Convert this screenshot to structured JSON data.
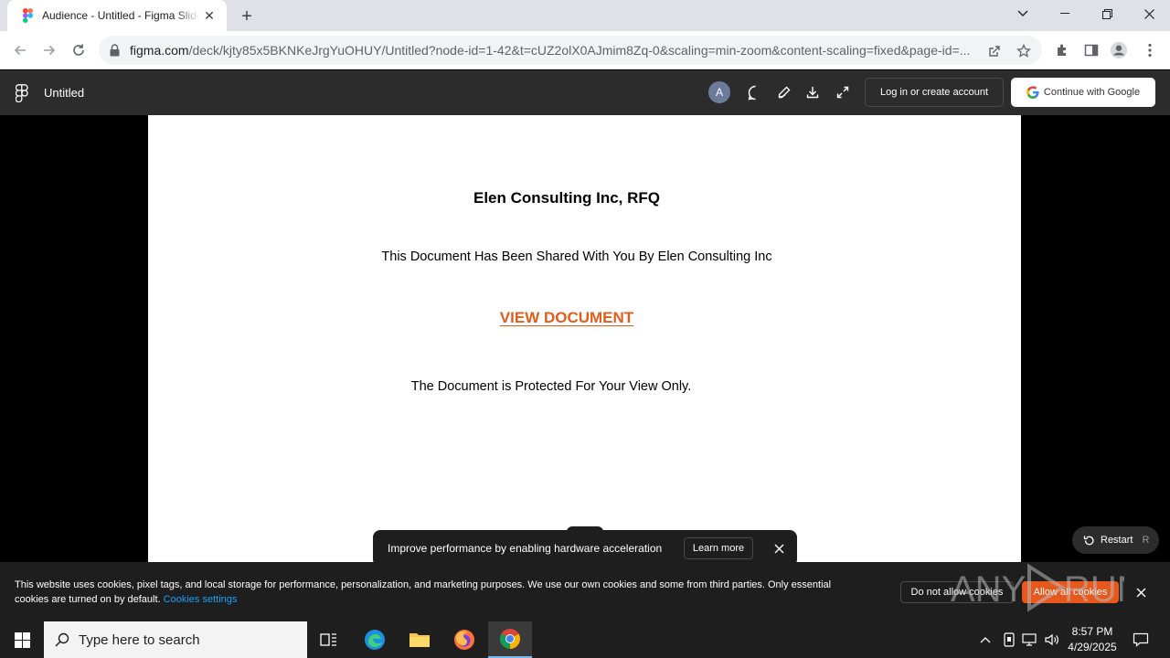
{
  "browser": {
    "tab_title": "Audience - Untitled - Figma Slides",
    "url_host": "figma.com",
    "url_path": "/deck/kjty85x5BKNKeJrgYuOHUY/Untitled?node-id=1-42&t=cUZ2olX0AJmim8Zq-0&scaling=min-zoom&content-scaling=fixed&page-id=..."
  },
  "figma": {
    "doc_title": "Untitled",
    "avatar_letter": "A",
    "login_label": "Log in or create account",
    "google_label": "Continue with Google"
  },
  "slide": {
    "title": "Elen Consulting Inc, RFQ",
    "subtitle": "This Document Has Been Shared With You By Elen Consulting Inc",
    "link_label": "VIEW DOCUMENT",
    "note": "The Document is Protected For Your View Only."
  },
  "toast": {
    "text": "Improve performance by enabling hardware acceleration",
    "learn_more": "Learn more"
  },
  "restart": {
    "label": "Restart",
    "key": "R"
  },
  "cookie": {
    "text": "This website uses cookies, pixel tags, and local storage for performance, personalization, and marketing purposes. We use our own cookies and some from third parties. Only essential cookies are turned on by default.",
    "settings_link": "Cookies settings",
    "deny_label": "Do not allow cookies",
    "allow_label": "Allow all cookies"
  },
  "taskbar": {
    "search_placeholder": "Type here to search",
    "time": "8:57 PM",
    "date": "4/29/2025"
  },
  "colors": {
    "link_orange": "#e05d1a",
    "allow_orange": "#e8571b",
    "figma_header": "#2c2c2c"
  }
}
